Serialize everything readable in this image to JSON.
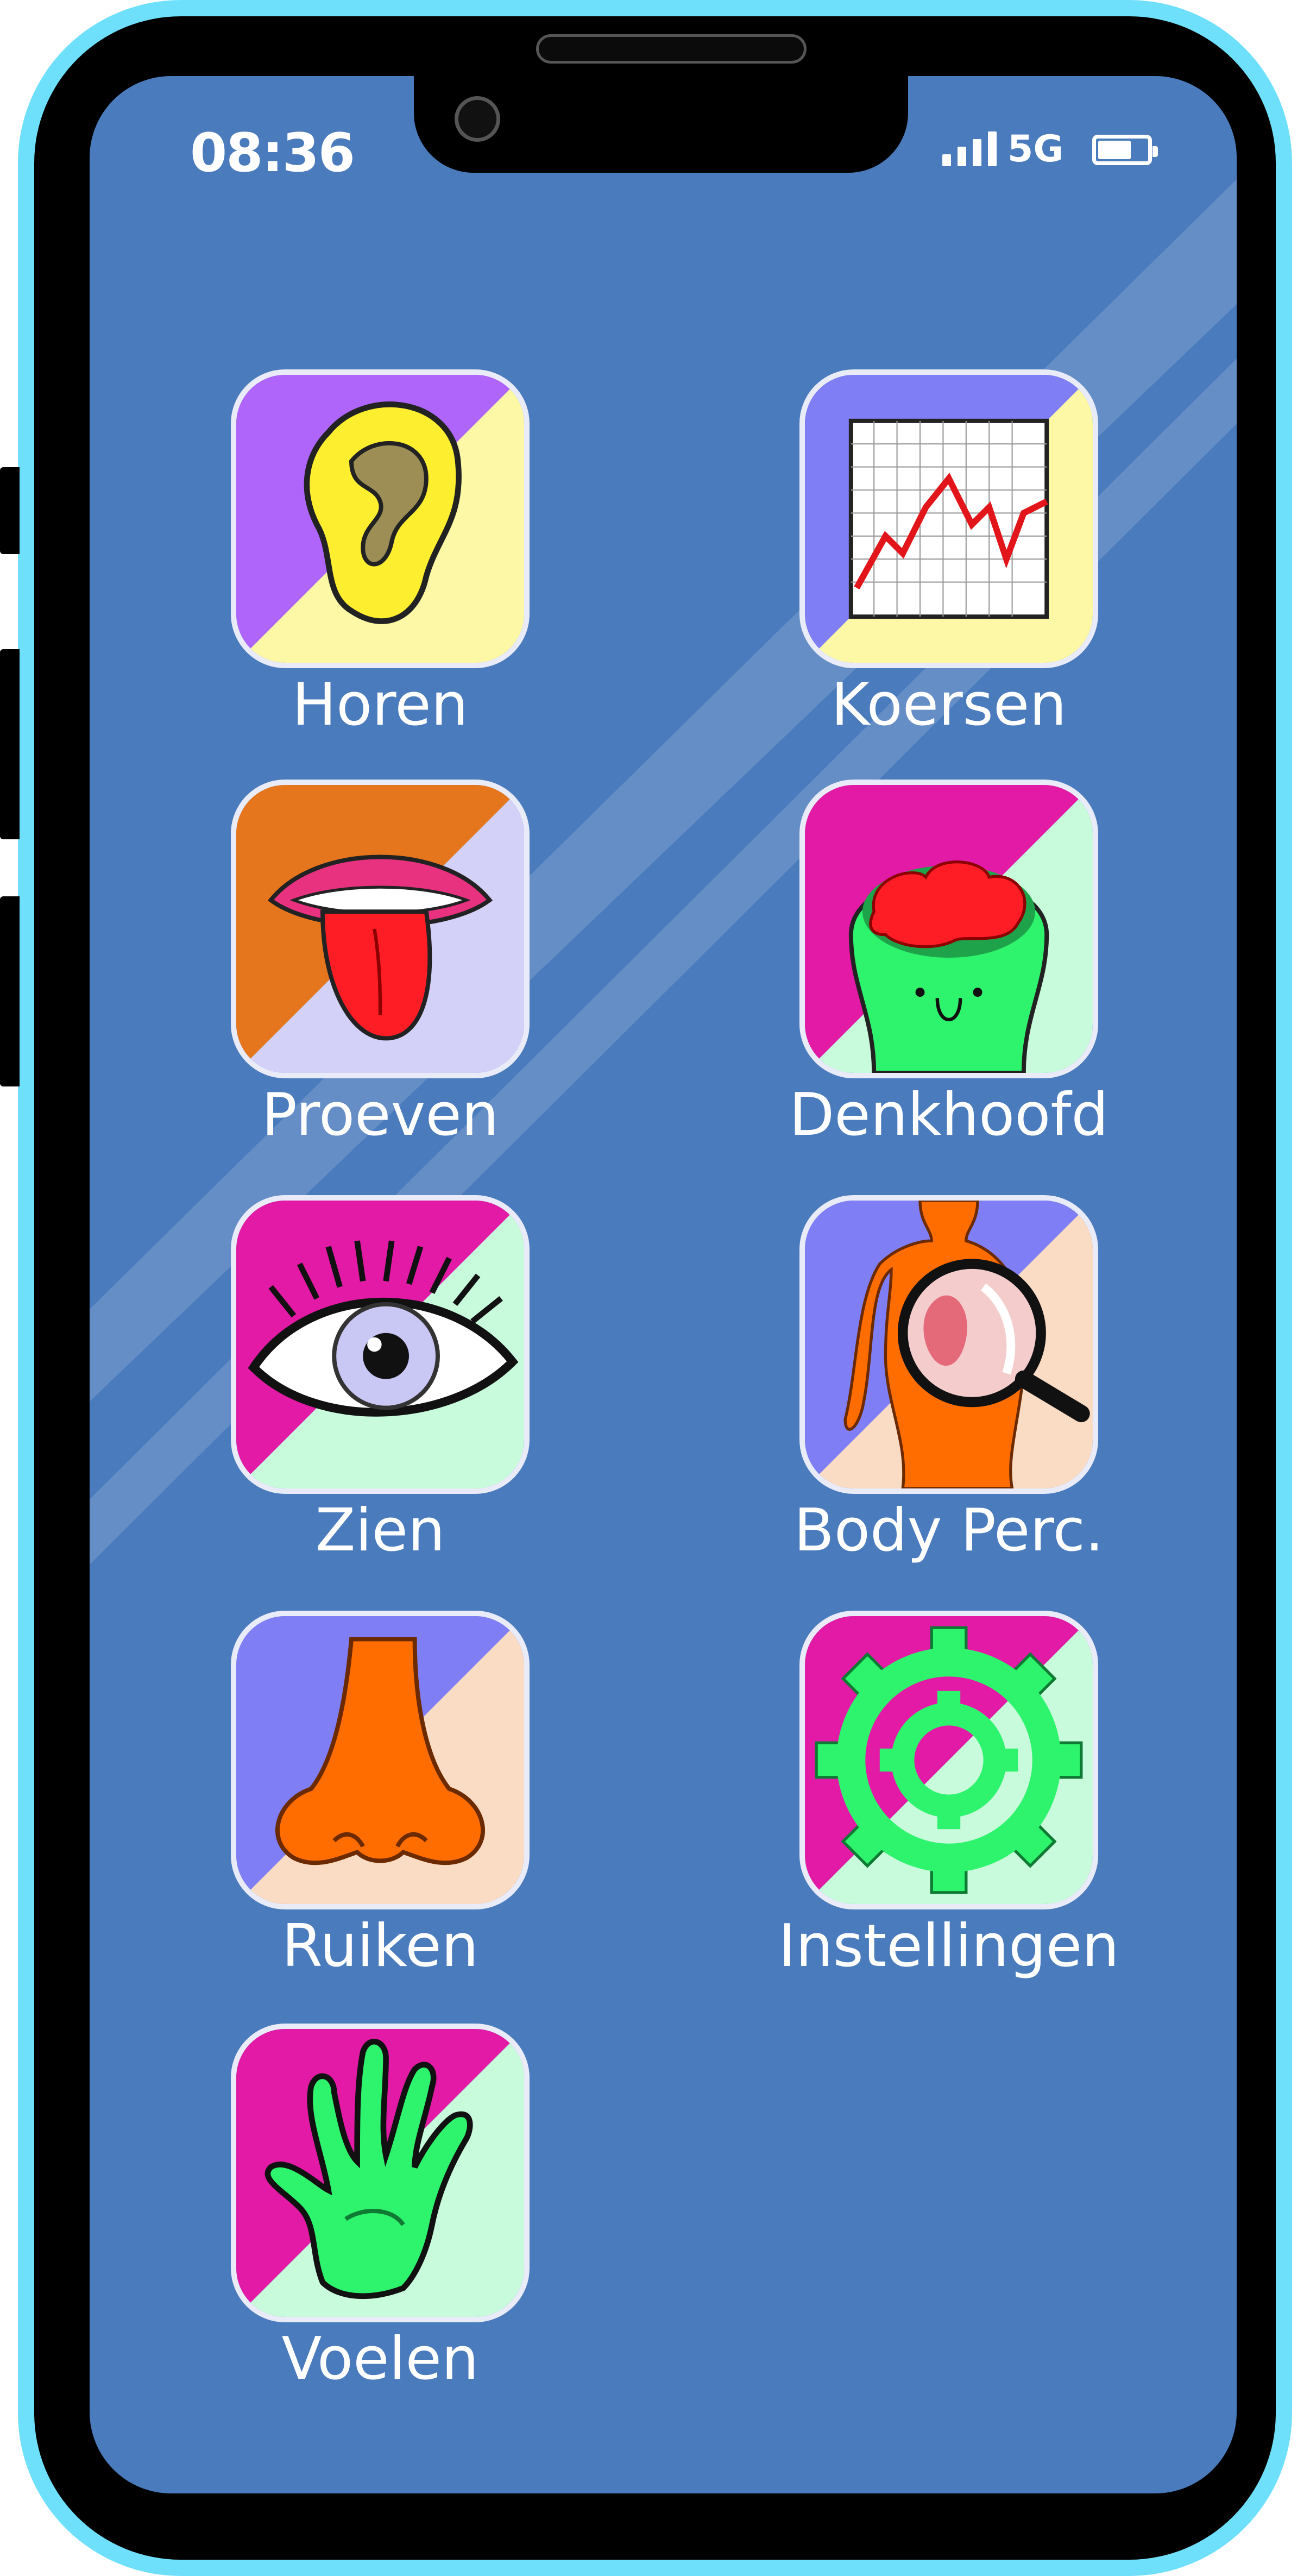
{
  "status_bar": {
    "time": "08:36",
    "network": "5G",
    "icons": [
      "signal-bars-icon",
      "battery-icon"
    ]
  },
  "apps": [
    {
      "label": "Horen",
      "icon": "ear-icon",
      "colors": [
        "#b065fa",
        "#fdf8a5"
      ]
    },
    {
      "label": "Koersen",
      "icon": "stock-chart-icon",
      "colors": [
        "#7f7ef4",
        "#fdf8a5"
      ]
    },
    {
      "label": "Proeven",
      "icon": "tongue-icon",
      "colors": [
        "#e6761d",
        "#d3d1f7"
      ]
    },
    {
      "label": "Denkhoofd",
      "icon": "brain-head-icon",
      "colors": [
        "#e21aa5",
        "#c8fadc"
      ]
    },
    {
      "label": "Zien",
      "icon": "eye-icon",
      "colors": [
        "#e21aa5",
        "#c8fadc"
      ]
    },
    {
      "label": "Body Perc.",
      "icon": "body-magnifier-icon",
      "colors": [
        "#7f7ef4",
        "#fadbc4"
      ]
    },
    {
      "label": "Ruiken",
      "icon": "nose-icon",
      "colors": [
        "#7f7ef4",
        "#fadbc4"
      ]
    },
    {
      "label": "Instellingen",
      "icon": "gear-icon",
      "colors": [
        "#e21aa5",
        "#c8fadc"
      ]
    },
    {
      "label": "Voelen",
      "icon": "hand-icon",
      "colors": [
        "#e21aa5",
        "#c8fadc"
      ]
    }
  ]
}
